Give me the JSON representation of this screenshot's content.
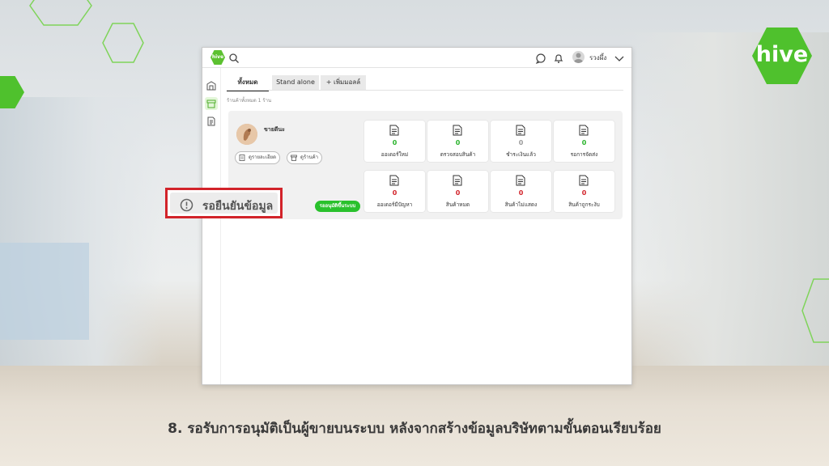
{
  "brand": {
    "logo_text": "hive",
    "app_logo_text": "hive",
    "accent": "#5cc130"
  },
  "topbar": {
    "user_name": "รวงผึ้ง"
  },
  "tabs": [
    {
      "label": "ทั้งหมด"
    },
    {
      "label": "Stand alone"
    },
    {
      "label": "+ เพิ่มมอลล์"
    }
  ],
  "shop_count": "ร้านค้าทั้งหมด 1 ร้าน",
  "shop": {
    "name": "ขายดีนะ",
    "detail_button": "ดูรายละเอียด",
    "store_button": "ดูร้านค้า",
    "approve_label": "รออนุมัติขึ้นระบบ"
  },
  "stats_top": [
    {
      "value": "0",
      "label": "ออเดอร์ใหม่",
      "color": "#29b32b"
    },
    {
      "value": "0",
      "label": "ตรวจสอบสินค้า",
      "color": "#29b32b"
    },
    {
      "value": "0",
      "label": "ชำระเงินแล้ว",
      "color": "#9a9a9a"
    },
    {
      "value": "0",
      "label": "รอการจัดส่ง",
      "color": "#29b32b"
    }
  ],
  "stats_bottom": [
    {
      "value": "0",
      "label": "ออเดอร์มีปัญหา",
      "color": "#d2232a"
    },
    {
      "value": "0",
      "label": "สินค้าหมด",
      "color": "#d2232a"
    },
    {
      "value": "0",
      "label": "สินค้าไม่แสดง",
      "color": "#d2232a"
    },
    {
      "value": "0",
      "label": "สินค้าถูกระงับ",
      "color": "#d2232a"
    }
  ],
  "callout": {
    "label": "รอยืนยันข้อมูล",
    "border_color": "#d2232a"
  },
  "caption": "8. รอรับการอนุมัติเป็นผู้ขายบนระบบ หลังจากสร้างข้อมูลบริษัทตามขั้นตอนเรียบร้อย"
}
